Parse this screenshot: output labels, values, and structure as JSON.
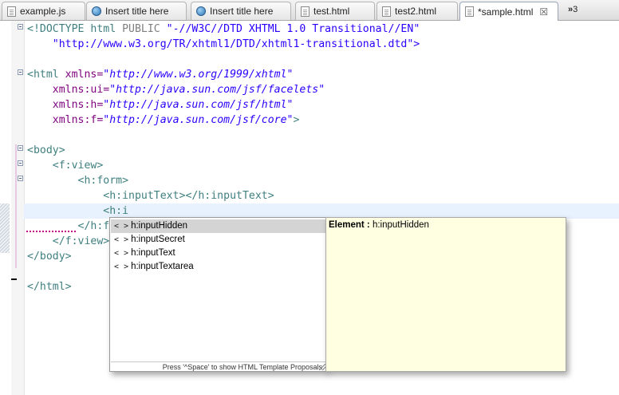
{
  "tabs": [
    {
      "label": "example.js",
      "icon": "js-file-icon"
    },
    {
      "label": "Insert title here",
      "icon": "globe-icon"
    },
    {
      "label": "Insert title here",
      "icon": "globe-icon"
    },
    {
      "label": "test.html",
      "icon": "html-file-icon"
    },
    {
      "label": "test2.html",
      "icon": "html-file-icon"
    },
    {
      "label": "*sample.html",
      "icon": "html-file-icon",
      "active": true,
      "close": "☒"
    }
  ],
  "overflow": {
    "chevron": "»",
    "count": "3"
  },
  "code": {
    "l1_a": "<!DOCTYPE html ",
    "l1_b": "PUBLIC ",
    "l1_c": "\"-//W3C//DTD XHTML 1.0 Transitional//EN\"",
    "l2": "    \"http://www.w3.org/TR/xhtml1/DTD/xhtml1-transitional.dtd\">",
    "l4_tag": "<html ",
    "l4_attr": "xmlns=",
    "l4_val": "\"http://www.w3.org/1999/xhtml\"",
    "l5_attr": "    xmlns:ui=",
    "l5_val": "\"http://java.sun.com/jsf/facelets\"",
    "l6_attr": "    xmlns:h=",
    "l6_val": "\"http://java.sun.com/jsf/html\"",
    "l7_attr": "    xmlns:f=",
    "l7_val": "\"http://java.sun.com/jsf/core\"",
    "l7_end": ">",
    "l9": "<body>",
    "l10": "    <f:view>",
    "l11": "        <h:form>",
    "l12": "            <h:inputText></h:inputText>",
    "l13": "            <h:i",
    "l14": "        </h:f",
    "l15": "    </f:view>",
    "l16": "</body>",
    "l18": "</html>"
  },
  "completion": {
    "items": [
      "h:inputHidden",
      "h:inputSecret",
      "h:inputText",
      "h:inputTextarea"
    ],
    "selected_index": 0,
    "item_icon": "< >",
    "footer": "Press '^Space' to show HTML Template Proposals"
  },
  "info": {
    "label": "Element : ",
    "value": "h:inputHidden"
  }
}
